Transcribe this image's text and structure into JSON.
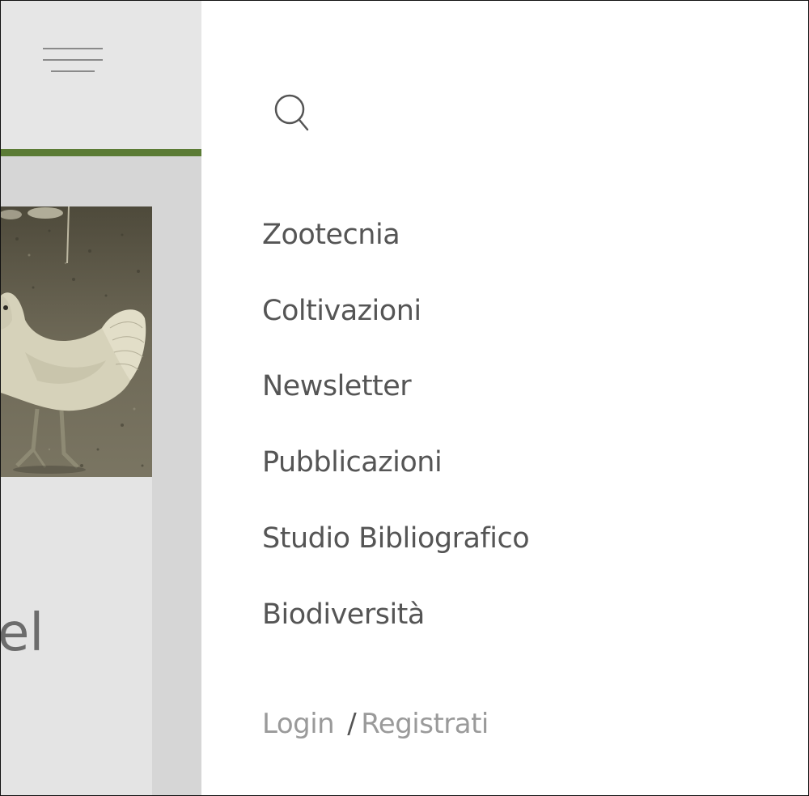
{
  "background_page": {
    "article_text_fragment": "el"
  },
  "menu": {
    "items": [
      {
        "label": "Zootecnia"
      },
      {
        "label": "Coltivazioni"
      },
      {
        "label": "Newsletter"
      },
      {
        "label": "Pubblicazioni"
      },
      {
        "label": "Studio Bibliografico"
      },
      {
        "label": "Biodiversità"
      }
    ],
    "auth": {
      "login": "Login",
      "separator": "/",
      "register": "Registrati"
    }
  },
  "icons": {
    "menu": "hamburger-icon",
    "search": "search-icon"
  },
  "colors": {
    "accent_green": "#5b7b35",
    "menu_text": "#555555",
    "muted_text": "#9a9a9a"
  }
}
